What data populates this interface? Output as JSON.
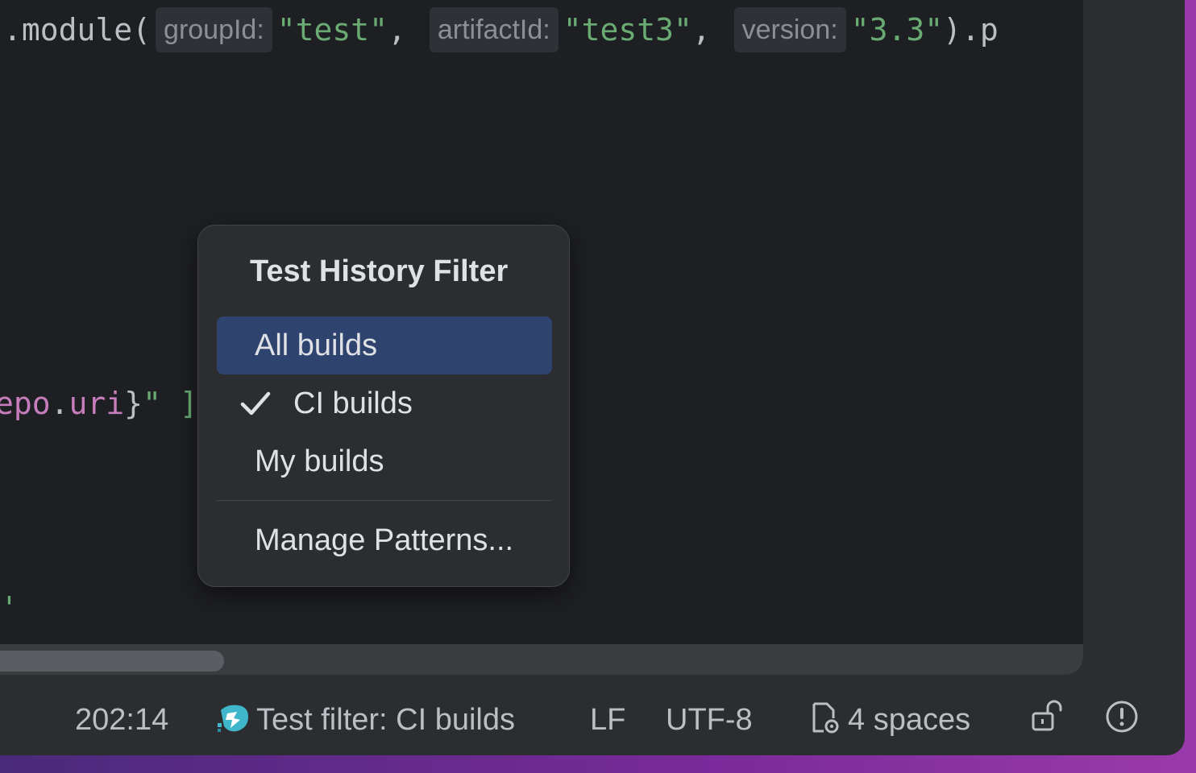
{
  "editor": {
    "line1": {
      "prefix": ".module(",
      "hint_group": "groupId:",
      "group_value": "\"test\"",
      "comma1": ",",
      "hint_artifact": "artifactId:",
      "artifact_value": "\"test3\"",
      "comma2": ",",
      "hint_version": "version:",
      "version_value": "\"3.3\"",
      "suffix": ").p"
    },
    "line2": {
      "epo": "epo",
      "dot": ".",
      "uri": "uri",
      "brace": "}",
      "quote": "\"",
      "rest": " ]"
    },
    "line3": {
      "text": "'"
    }
  },
  "popup": {
    "title": "Test History Filter",
    "items": [
      {
        "label": "All builds",
        "selected": true,
        "checked": false
      },
      {
        "label": "CI builds",
        "selected": false,
        "checked": true
      },
      {
        "label": "My builds",
        "selected": false,
        "checked": false
      }
    ],
    "manage_label": "Manage Patterns..."
  },
  "statusbar": {
    "position": "202:14",
    "filter": "Test filter: CI builds",
    "line_ending": "LF",
    "encoding": "UTF-8",
    "indent": "4 spaces",
    "icons": {
      "filter": "test-history-icon",
      "indent": "file-settings-icon",
      "lock": "unlock-icon",
      "warning": "warning-icon"
    }
  },
  "colors": {
    "selection": "#2e436e",
    "string": "#6aab73",
    "field": "#c77dbb"
  }
}
